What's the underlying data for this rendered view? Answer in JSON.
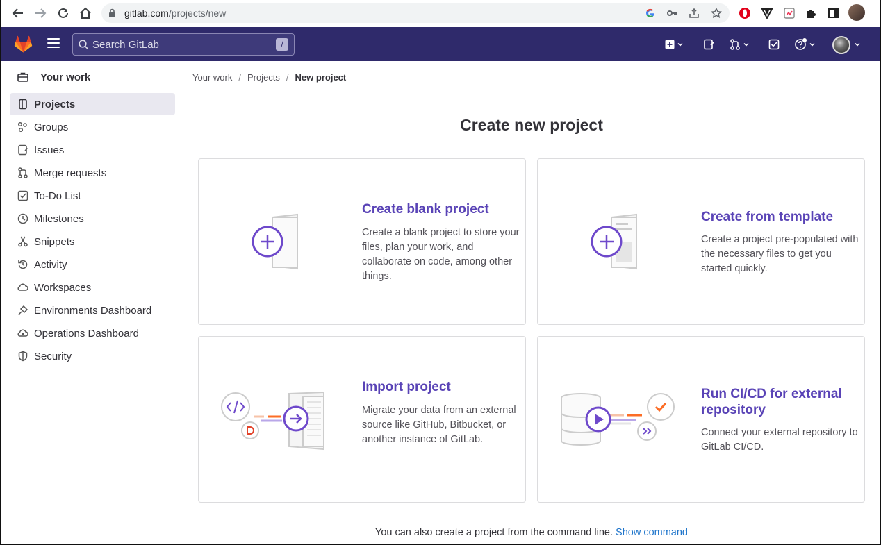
{
  "browser": {
    "url_host": "gitlab.com",
    "url_path": "/projects/new"
  },
  "topbar": {
    "search_placeholder": "Search GitLab",
    "search_shortcut": "/"
  },
  "sidebar": {
    "context_title": "Your work",
    "items": [
      {
        "label": "Projects",
        "icon": "project-icon",
        "active": true
      },
      {
        "label": "Groups",
        "icon": "group-icon"
      },
      {
        "label": "Issues",
        "icon": "issues-icon"
      },
      {
        "label": "Merge requests",
        "icon": "merge-request-icon"
      },
      {
        "label": "To-Do List",
        "icon": "todo-icon"
      },
      {
        "label": "Milestones",
        "icon": "clock-icon"
      },
      {
        "label": "Snippets",
        "icon": "snippet-icon"
      },
      {
        "label": "Activity",
        "icon": "history-icon"
      },
      {
        "label": "Workspaces",
        "icon": "cloud-icon"
      },
      {
        "label": "Environments Dashboard",
        "icon": "environment-icon"
      },
      {
        "label": "Operations Dashboard",
        "icon": "cloud-gear-icon"
      },
      {
        "label": "Security",
        "icon": "shield-icon"
      }
    ]
  },
  "breadcrumb": [
    "Your work",
    "Projects",
    "New project"
  ],
  "page_title": "Create new project",
  "cards": [
    {
      "title": "Create blank project",
      "desc": "Create a blank project to store your files, plan your work, and collaborate on code, among other things."
    },
    {
      "title": "Create from template",
      "desc": "Create a project pre-populated with the necessary files to get you started quickly."
    },
    {
      "title": "Import project",
      "desc": "Migrate your data from an external source like GitHub, Bitbucket, or another instance of GitLab."
    },
    {
      "title": "Run CI/CD for external repository",
      "desc": "Connect your external repository to GitLab CI/CD."
    }
  ],
  "footer": {
    "text": "You can also create a project from the command line.",
    "link": "Show command"
  },
  "colors": {
    "brand_purple": "#5943b6",
    "topbar": "#2f2a6b",
    "link_blue": "#1f75cb"
  }
}
